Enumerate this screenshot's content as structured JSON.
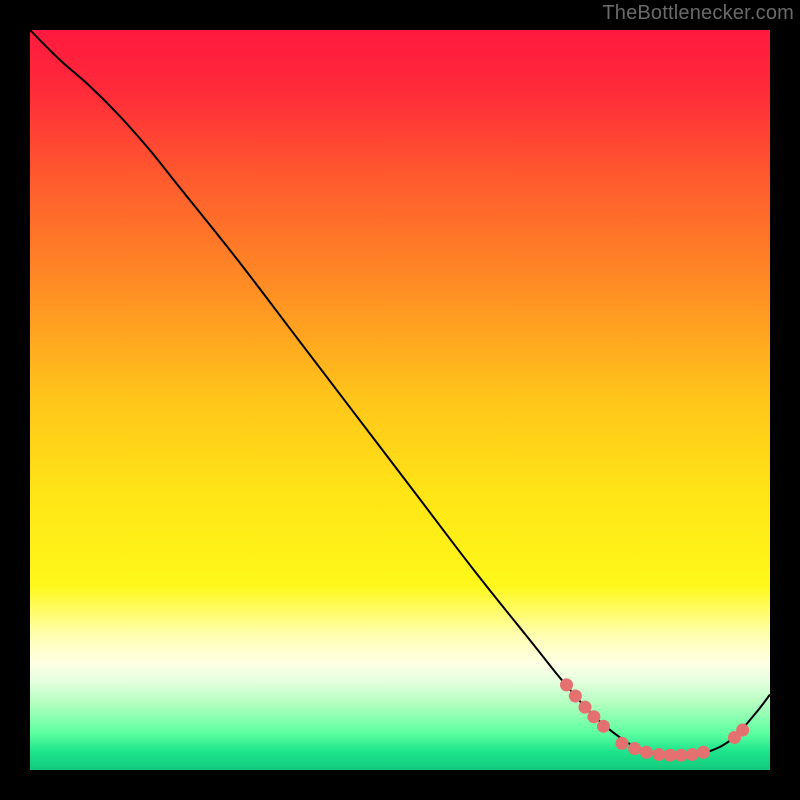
{
  "watermark": "TheBottlenecker.com",
  "chart_data": {
    "type": "line",
    "title": "",
    "xlabel": "",
    "ylabel": "",
    "xlim": [
      0,
      100
    ],
    "ylim": [
      0,
      100
    ],
    "background_gradient": {
      "stops": [
        {
          "pct": 0.0,
          "color": "#ff1a3f"
        },
        {
          "pct": 0.08,
          "color": "#ff2a3a"
        },
        {
          "pct": 0.2,
          "color": "#ff5a2e"
        },
        {
          "pct": 0.35,
          "color": "#ff8e24"
        },
        {
          "pct": 0.5,
          "color": "#ffc61a"
        },
        {
          "pct": 0.63,
          "color": "#ffe516"
        },
        {
          "pct": 0.75,
          "color": "#fff81a"
        },
        {
          "pct": 0.82,
          "color": "#ffffb5"
        },
        {
          "pct": 0.855,
          "color": "#ffffe4"
        },
        {
          "pct": 0.88,
          "color": "#e5ffdf"
        },
        {
          "pct": 0.91,
          "color": "#b3ffc0"
        },
        {
          "pct": 0.95,
          "color": "#5dffa0"
        },
        {
          "pct": 0.975,
          "color": "#1de48c"
        },
        {
          "pct": 1.0,
          "color": "#12c97c"
        }
      ]
    },
    "series": [
      {
        "name": "curve",
        "color": "#000000",
        "data": [
          {
            "x": 0,
            "y": 100
          },
          {
            "x": 4,
            "y": 96
          },
          {
            "x": 8,
            "y": 92.5
          },
          {
            "x": 12,
            "y": 88.5
          },
          {
            "x": 16,
            "y": 84
          },
          {
            "x": 20,
            "y": 79
          },
          {
            "x": 28,
            "y": 69
          },
          {
            "x": 36,
            "y": 58.5
          },
          {
            "x": 44,
            "y": 48
          },
          {
            "x": 52,
            "y": 37.5
          },
          {
            "x": 60,
            "y": 27
          },
          {
            "x": 68,
            "y": 17
          },
          {
            "x": 72,
            "y": 12
          },
          {
            "x": 76,
            "y": 7.5
          },
          {
            "x": 80,
            "y": 4.2
          },
          {
            "x": 83,
            "y": 2.6
          },
          {
            "x": 86,
            "y": 2.0
          },
          {
            "x": 89,
            "y": 2.0
          },
          {
            "x": 92,
            "y": 2.6
          },
          {
            "x": 95,
            "y": 4.3
          },
          {
            "x": 98,
            "y": 7.6
          },
          {
            "x": 100,
            "y": 10.2
          }
        ]
      }
    ],
    "markers": {
      "color": "#e4706f",
      "points": [
        {
          "x": 72.5,
          "y": 11.5
        },
        {
          "x": 73.7,
          "y": 10
        },
        {
          "x": 75,
          "y": 8.5
        },
        {
          "x": 76.2,
          "y": 7.2
        },
        {
          "x": 77.5,
          "y": 5.9
        },
        {
          "x": 80,
          "y": 3.6
        },
        {
          "x": 81.7,
          "y": 2.9
        },
        {
          "x": 83.3,
          "y": 2.4
        },
        {
          "x": 85,
          "y": 2.1
        },
        {
          "x": 86.5,
          "y": 2.0
        },
        {
          "x": 88,
          "y": 2.0
        },
        {
          "x": 89.5,
          "y": 2.1
        },
        {
          "x": 91,
          "y": 2.4
        },
        {
          "x": 95.2,
          "y": 4.4
        },
        {
          "x": 96.3,
          "y": 5.4
        }
      ]
    }
  }
}
